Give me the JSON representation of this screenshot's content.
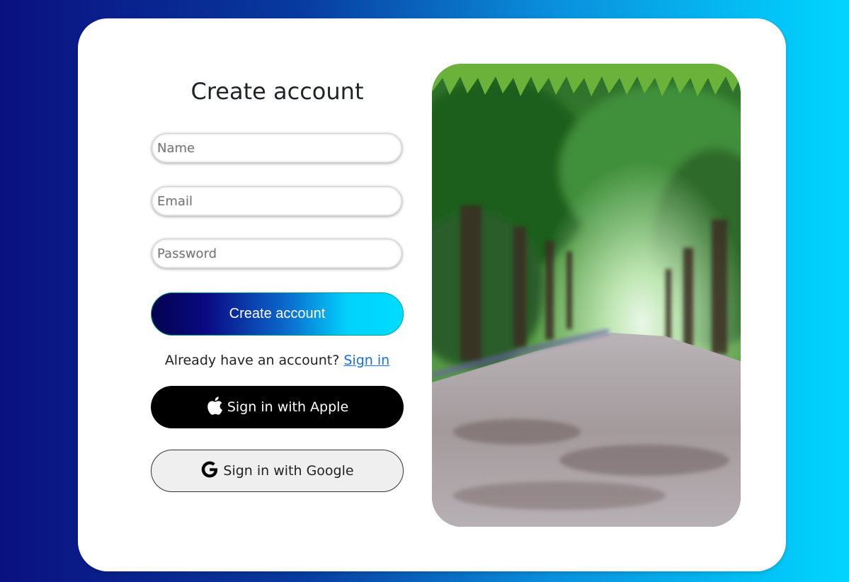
{
  "form": {
    "title": "Create account",
    "name_placeholder": "Name",
    "email_placeholder": "Email",
    "password_placeholder": "Password",
    "submit_label": "Create account",
    "signin_prompt": "Already have an account?",
    "signin_link": "Sign in",
    "apple_label": "Sign in with Apple",
    "google_label": "Sign in with Google"
  },
  "icons": {
    "apple": "apple-icon",
    "google": "google-icon"
  },
  "colors": {
    "background_start": "#0a1080",
    "background_end": "#00d6ff",
    "link": "#1a6fdc",
    "apple_button": "#000000",
    "google_button": "#efefef"
  }
}
